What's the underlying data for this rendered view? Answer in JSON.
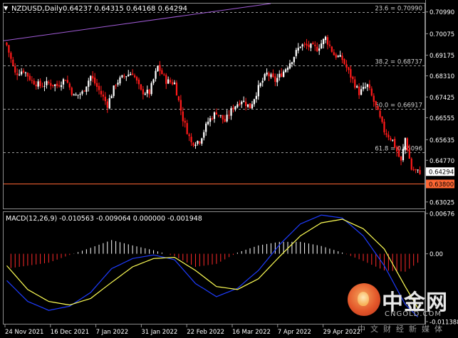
{
  "chart_header": {
    "dropdown_glyph": "▼",
    "symbol_tf": "NZDUSD,Daily",
    "ohlc": "0.64237 0.64315 0.64168 0.64294"
  },
  "colors": {
    "background": "#000000",
    "bull_candle": "#ffffff",
    "bear_candle": "#ff1a1a",
    "trendline": "#a05bd6",
    "level_line": "#ff6633",
    "macd_main": "#1e3cff",
    "macd_signal": "#ffff55",
    "macd_hist_pos": "#ffffff",
    "macd_hist_neg": "#ff2a2a",
    "grid": "#8c8c8c",
    "current_price_box": "#ffffff",
    "level_box": "#ff6633"
  },
  "chart_data": [
    {
      "type": "candlestick",
      "price_axis": {
        "ticks": [
          "0.70990",
          "0.70075",
          "0.69175",
          "0.68310",
          "0.67425",
          "0.66555",
          "0.65635",
          "0.64770",
          "0.63025"
        ],
        "range": [
          0.6275,
          0.7134
        ]
      },
      "time_axis": {
        "labels": [
          "24 Nov 2021",
          "16 Dec 2021",
          "7 Jan 2022",
          "31 Jan 2022",
          "22 Feb 2022",
          "16 Mar 2022",
          "7 Apr 2022",
          "29 Apr 2022"
        ]
      },
      "fib_levels": [
        {
          "label": "23.6 = 0.70990",
          "price": 0.7099
        },
        {
          "label": "38.2 = 0.68737",
          "price": 0.68737
        },
        {
          "label": "50.0 = 0.66917",
          "price": 0.66917
        },
        {
          "label": "61.8 = 0.65096",
          "price": 0.65096
        }
      ],
      "current_price": "0.64294",
      "horizontal_level": "0.63800",
      "close_path": [
        [
          0,
          0.696
        ],
        [
          4,
          0.684
        ],
        [
          8,
          0.6855
        ],
        [
          12,
          0.681
        ],
        [
          16,
          0.679
        ],
        [
          20,
          0.68
        ],
        [
          24,
          0.679
        ],
        [
          28,
          0.682
        ],
        [
          32,
          0.6745
        ],
        [
          36,
          0.676
        ],
        [
          40,
          0.683
        ],
        [
          44,
          0.677
        ],
        [
          48,
          0.671
        ],
        [
          52,
          0.68
        ],
        [
          56,
          0.683
        ],
        [
          60,
          0.6845
        ],
        [
          64,
          0.6765
        ],
        [
          68,
          0.676
        ],
        [
          72,
          0.687
        ],
        [
          76,
          0.681
        ],
        [
          80,
          0.68
        ],
        [
          84,
          0.665
        ],
        [
          88,
          0.655
        ],
        [
          92,
          0.656
        ],
        [
          96,
          0.664
        ],
        [
          100,
          0.668
        ],
        [
          104,
          0.664
        ],
        [
          108,
          0.67
        ],
        [
          112,
          0.673
        ],
        [
          116,
          0.67
        ],
        [
          120,
          0.678
        ],
        [
          124,
          0.684
        ],
        [
          128,
          0.681
        ],
        [
          132,
          0.685
        ],
        [
          136,
          0.69
        ],
        [
          140,
          0.696
        ],
        [
          144,
          0.6955
        ],
        [
          148,
          0.6945
        ],
        [
          152,
          0.699
        ],
        [
          156,
          0.692
        ],
        [
          160,
          0.69
        ],
        [
          164,
          0.683
        ],
        [
          168,
          0.676
        ],
        [
          172,
          0.679
        ],
        [
          176,
          0.67
        ],
        [
          180,
          0.66
        ],
        [
          184,
          0.656
        ],
        [
          188,
          0.647
        ],
        [
          190,
          0.657
        ],
        [
          193,
          0.644
        ],
        [
          196,
          0.6429
        ]
      ]
    },
    {
      "type": "macd",
      "title": "MACD(12,26,9) -0.010563 -0.009064 0.000000 -0.001948",
      "ticks": [
        "0.00676",
        "0.00",
        "-0.011388"
      ],
      "range": [
        -0.01175,
        0.007
      ],
      "main": [
        [
          0,
          -0.0045
        ],
        [
          10,
          -0.008
        ],
        [
          20,
          -0.0095
        ],
        [
          30,
          -0.0088
        ],
        [
          40,
          -0.0065
        ],
        [
          50,
          -0.0025
        ],
        [
          60,
          -0.0008
        ],
        [
          70,
          -0.0002
        ],
        [
          80,
          -0.001
        ],
        [
          90,
          -0.005
        ],
        [
          100,
          -0.0072
        ],
        [
          110,
          -0.0058
        ],
        [
          120,
          -0.0028
        ],
        [
          130,
          0.0015
        ],
        [
          140,
          0.005
        ],
        [
          150,
          0.0065
        ],
        [
          160,
          0.006
        ],
        [
          170,
          0.003
        ],
        [
          180,
          -0.002
        ],
        [
          190,
          -0.0085
        ],
        [
          196,
          -0.0106
        ]
      ],
      "signal": [
        [
          0,
          -0.002
        ],
        [
          10,
          -0.006
        ],
        [
          20,
          -0.008
        ],
        [
          30,
          -0.0086
        ],
        [
          40,
          -0.0075
        ],
        [
          50,
          -0.0048
        ],
        [
          60,
          -0.0022
        ],
        [
          70,
          -0.0008
        ],
        [
          80,
          -0.0006
        ],
        [
          90,
          -0.0028
        ],
        [
          100,
          -0.0055
        ],
        [
          110,
          -0.006
        ],
        [
          120,
          -0.0042
        ],
        [
          130,
          -0.0005
        ],
        [
          140,
          0.003
        ],
        [
          150,
          0.0052
        ],
        [
          160,
          0.0058
        ],
        [
          170,
          0.0042
        ],
        [
          180,
          0.0008
        ],
        [
          190,
          -0.0055
        ],
        [
          196,
          -0.0091
        ]
      ]
    }
  ],
  "watermark": {
    "brand": "中金网",
    "domain": "CNGOLD.COM",
    "slogan": "中文财经新媒体"
  }
}
